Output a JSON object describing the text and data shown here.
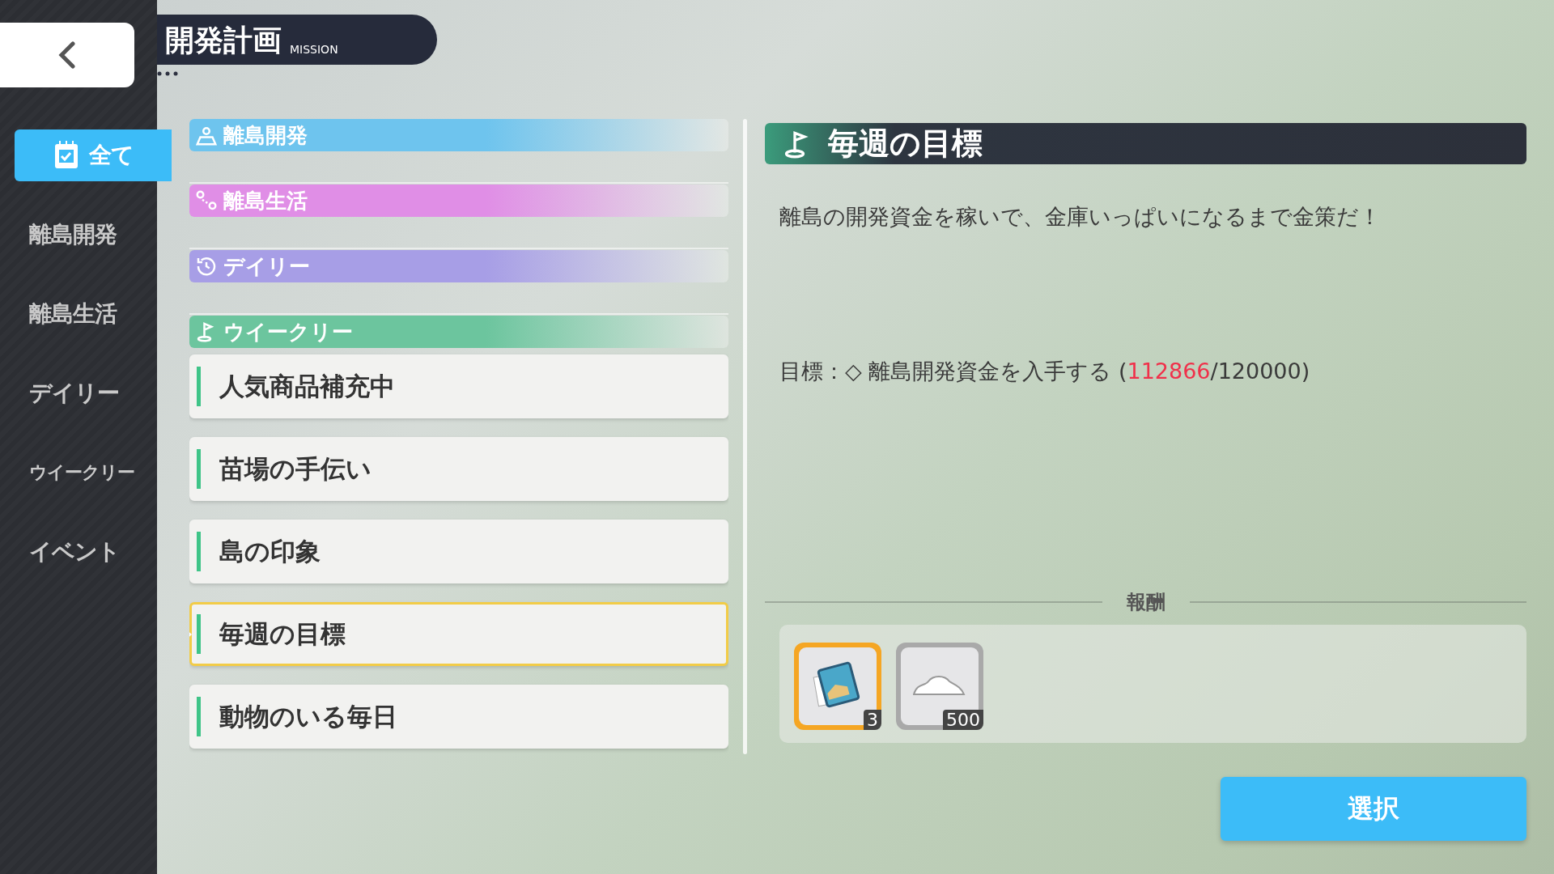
{
  "header": {
    "title": "開発計画",
    "subtitle": "MISSION"
  },
  "sidebar": {
    "items": [
      {
        "label": "全て",
        "selected": true
      },
      {
        "label": "離島開発",
        "selected": false
      },
      {
        "label": "離島生活",
        "selected": false
      },
      {
        "label": "デイリー",
        "selected": false
      },
      {
        "label": "ウイークリー",
        "selected": false
      },
      {
        "label": "イベント",
        "selected": false
      }
    ]
  },
  "categories": [
    {
      "kind": "island",
      "label": "離島開発",
      "color": "#6ec4ee"
    },
    {
      "kind": "life",
      "label": "離島生活",
      "color": "#e08ee6"
    },
    {
      "kind": "daily",
      "label": "デイリー",
      "color": "#a79ee6"
    },
    {
      "kind": "weekly",
      "label": "ウイークリー",
      "color": "#6cc59e",
      "missions": [
        {
          "label": "人気商品補充中",
          "selected": false
        },
        {
          "label": "苗場の手伝い",
          "selected": false
        },
        {
          "label": "島の印象",
          "selected": false
        },
        {
          "label": "毎週の目標",
          "selected": true
        },
        {
          "label": "動物のいる毎日",
          "selected": false
        }
      ]
    }
  ],
  "detail": {
    "title": "毎週の目標",
    "description": "離島の開発資金を稼いで、金庫いっぱいになるまで金策だ！",
    "goal": {
      "prefix": "目標：◇ 離島開発資金を入手する (",
      "current": "112866",
      "suffix": "/120000)"
    },
    "rewards_label": "報酬",
    "rewards": [
      {
        "kind": "skill-book",
        "count": "3",
        "color": "#f5a623"
      },
      {
        "kind": "exp",
        "count": "500",
        "color": "#a9a9a9"
      }
    ],
    "select_button": "選択"
  }
}
